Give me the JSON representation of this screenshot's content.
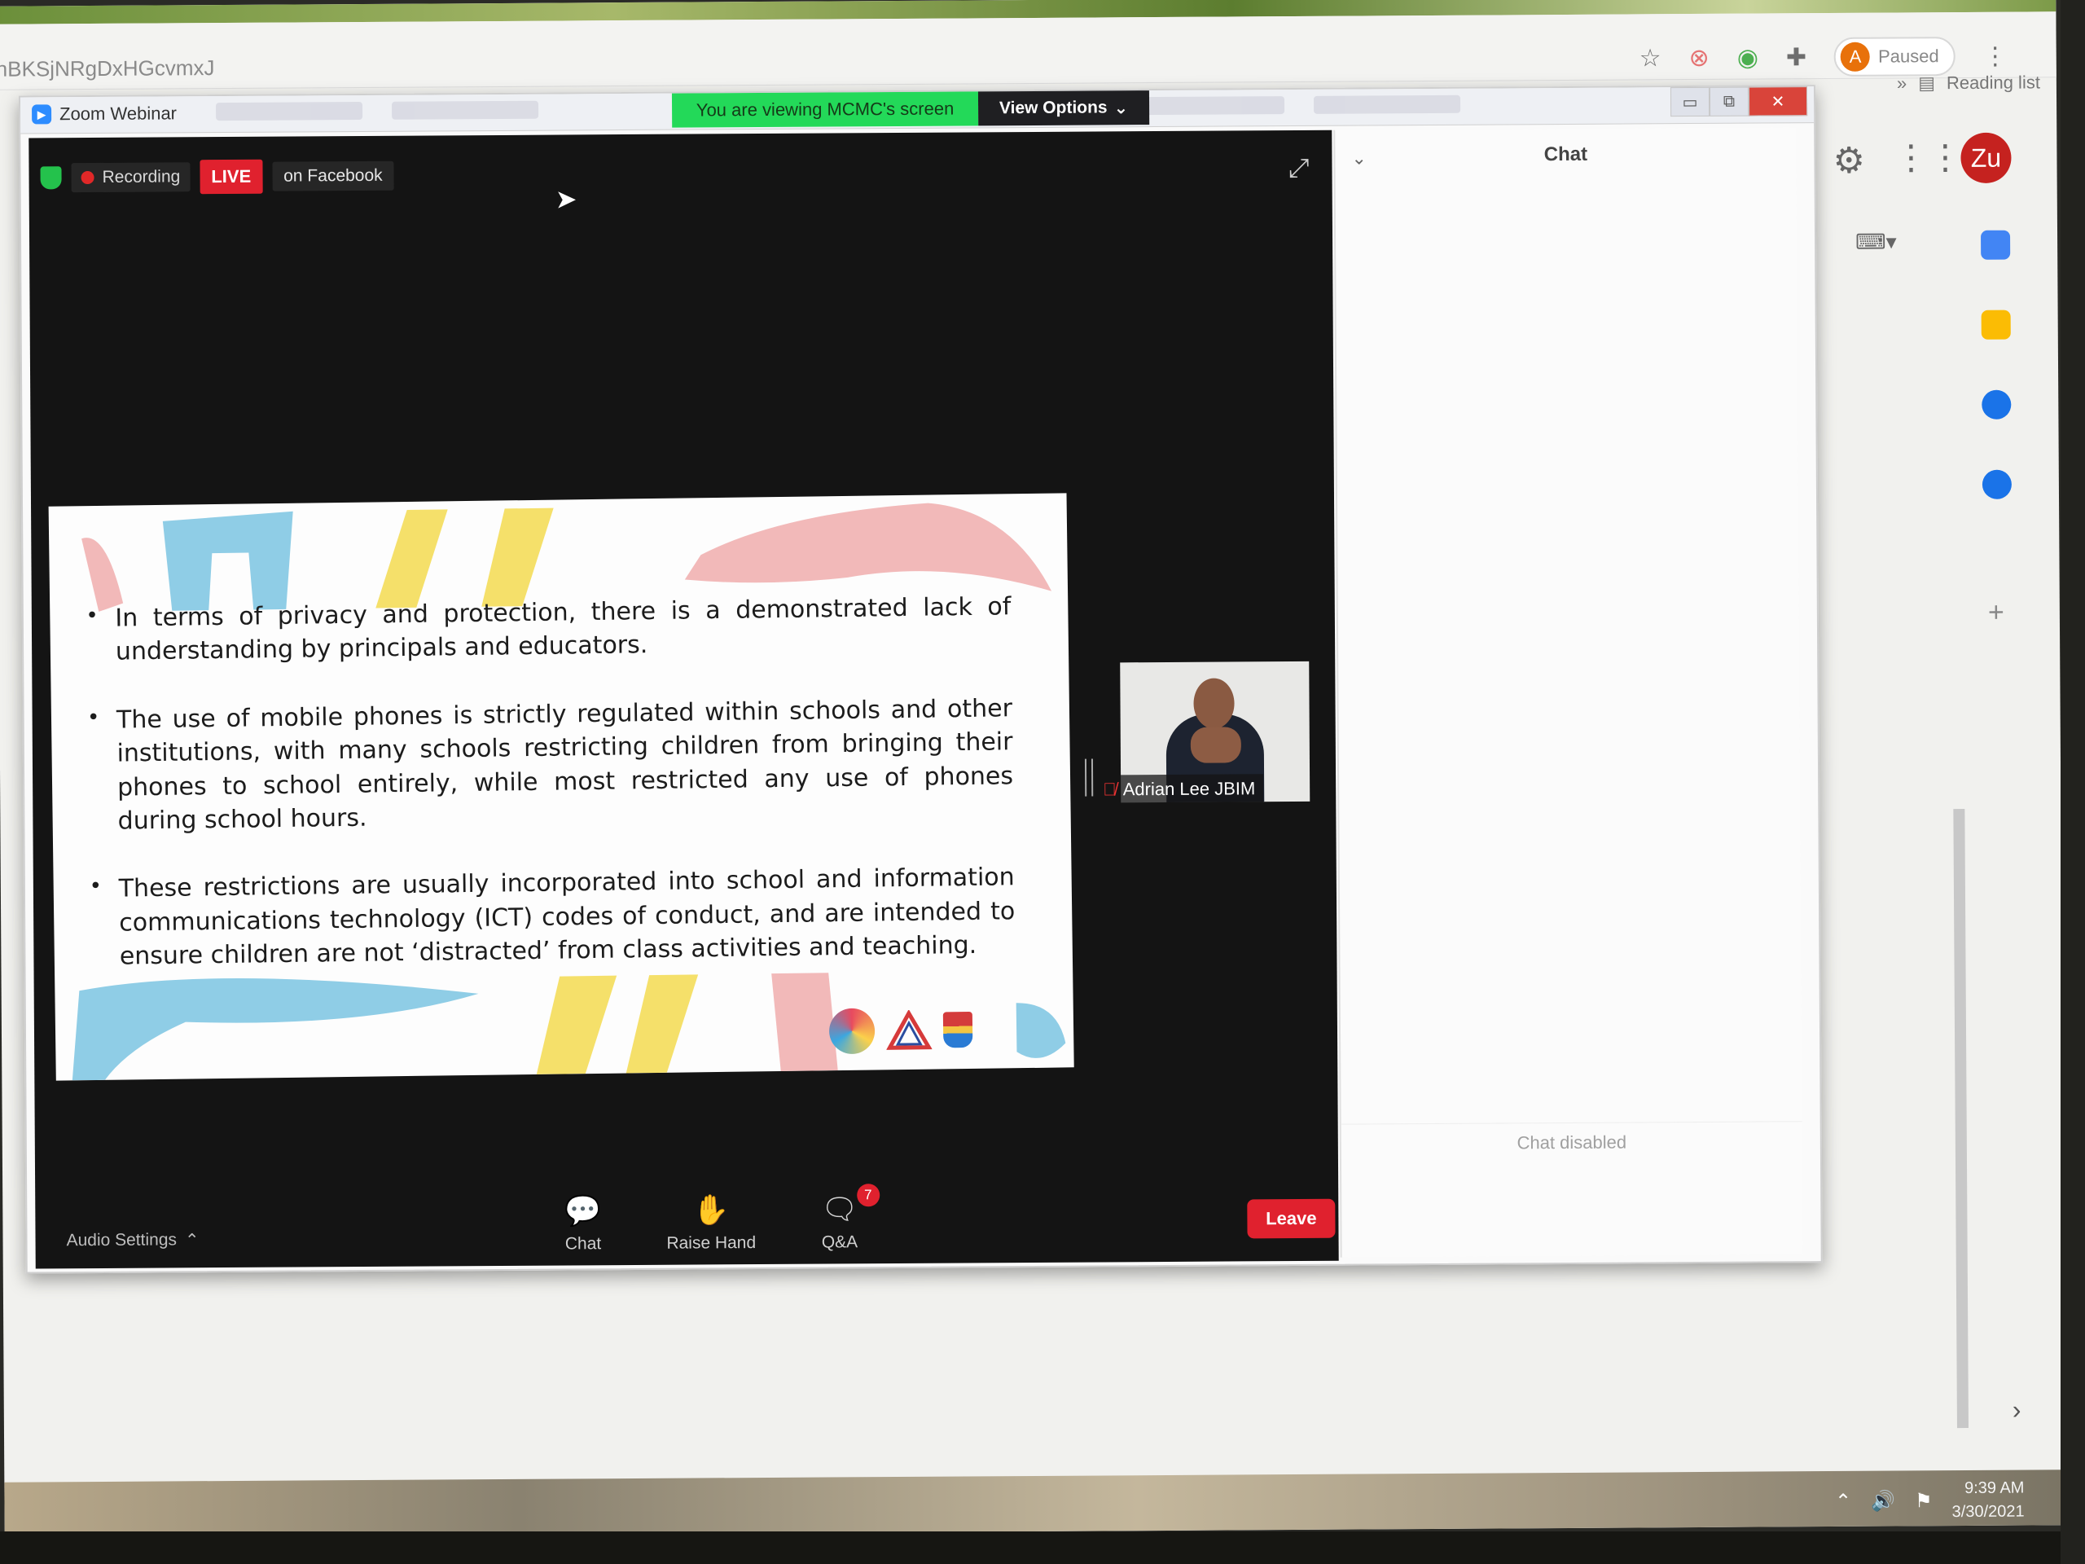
{
  "browser": {
    "url_fragment": "nBKSjNRgDxHGcvmxJ",
    "profile_initial": "A",
    "profile_status": "Paused",
    "reading_list": "Reading list",
    "account_initials": "Zu",
    "more_tabs": "»"
  },
  "zoom": {
    "window_title": "Zoom Webinar",
    "share_banner": "You are viewing MCMC's screen",
    "view_options": "View Options",
    "status": {
      "recording": "Recording",
      "live": "LIVE",
      "live_destination": "on Facebook"
    },
    "slide": {
      "bullets": [
        "In terms of privacy and protection, there is a demonstrated lack of understanding by principals and educators.",
        "The use of mobile phones is strictly regulated within schools and other institutions, with many schools restricting children from bringing their phones to school entirely, while most restricted any use of phones during school hours.",
        "These restrictions are usually incorporated into school and information communications technology (ICT) codes of conduct, and are intended to ensure children are not ‘distracted’ from class activities and teaching."
      ],
      "accent_colors": {
        "blue": "#8fcde6",
        "pink": "#f2b9b9",
        "yellow": "#f5e06a"
      }
    },
    "participant": {
      "name": "Adrian Lee  JBIM"
    },
    "toolbar": {
      "audio_settings": "Audio Settings",
      "chat": "Chat",
      "raise_hand": "Raise Hand",
      "qa": "Q&A",
      "qa_badge": "7",
      "leave": "Leave"
    },
    "chat_panel": {
      "title": "Chat",
      "disabled_text": "Chat disabled"
    },
    "colors": {
      "live_red": "#e0212e",
      "share_green": "#23d959",
      "leave_red": "#e0212e"
    }
  },
  "taskbar": {
    "time": "9:39 AM",
    "date": "3/30/2021"
  },
  "icons": {
    "star": "star-icon",
    "extensions": "puzzle-icon",
    "menu": "kebab-menu-icon",
    "settings": "gear-icon",
    "apps": "apps-grid-icon"
  }
}
